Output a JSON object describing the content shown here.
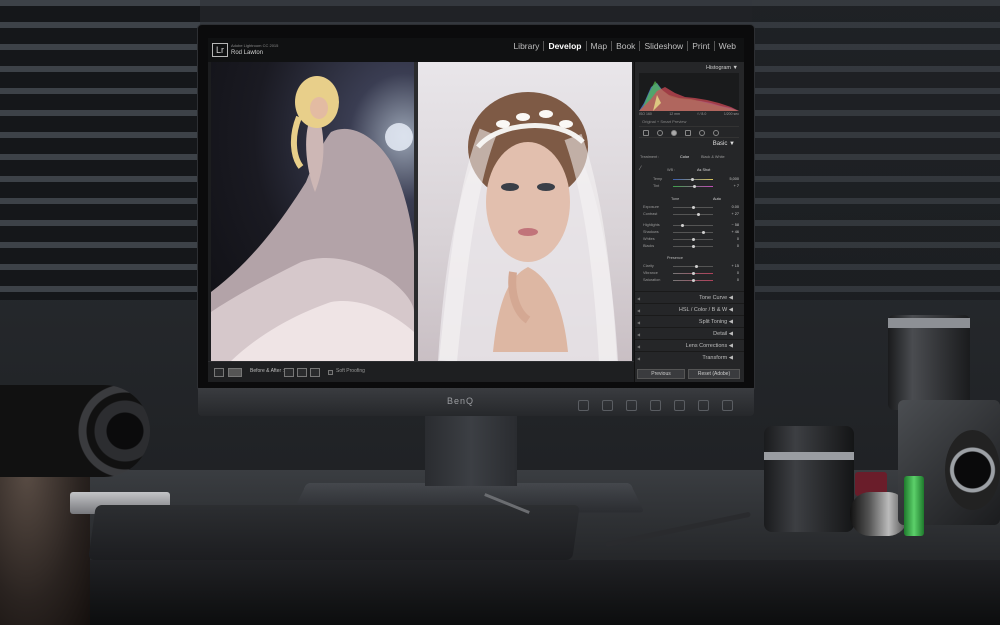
{
  "monitor": {
    "brand": "BenQ"
  },
  "app": {
    "logo": "Lr",
    "product": "Adobe Lightroom CC 2015",
    "user": "Rod Lawton",
    "modules": [
      {
        "label": "Library",
        "active": false
      },
      {
        "label": "Develop",
        "active": true
      },
      {
        "label": "Map",
        "active": false
      },
      {
        "label": "Book",
        "active": false
      },
      {
        "label": "Slideshow",
        "active": false
      },
      {
        "label": "Print",
        "active": false
      },
      {
        "label": "Web",
        "active": false
      }
    ]
  },
  "toolbar": {
    "before_after_label": "Before & After :",
    "soft_proofing_label": "Soft Proofing"
  },
  "panel": {
    "histogram_title": "Histogram ▼",
    "histogram_stats": [
      "ISO 160",
      "12 mm",
      "f / 8.0",
      "1/200 sec"
    ],
    "preview_label": "Original + Smart Preview",
    "basic": {
      "title": "Basic ▼",
      "treatment_label": "Treatment :",
      "color_label": "Color",
      "bw_label": "Black & White",
      "wb_label": "WB :",
      "wb_value": "As Shot",
      "temp_label": "Temp",
      "temp_value": "5,000",
      "tint_label": "Tint",
      "tint_value": "+ 7",
      "tone_label": "Tone",
      "auto_label": "Auto",
      "exposure_label": "Exposure",
      "exposure_value": "0.00",
      "contrast_label": "Contrast",
      "contrast_value": "+ 27",
      "highlights_label": "Highlights",
      "highlights_value": "− 58",
      "shadows_label": "Shadows",
      "shadows_value": "+ 46",
      "whites_label": "Whites",
      "whites_value": "0",
      "blacks_label": "Blacks",
      "blacks_value": "0",
      "presence_label": "Presence",
      "clarity_label": "Clarity",
      "clarity_value": "+ 15",
      "vibrance_label": "Vibrance",
      "vibrance_value": "0",
      "saturation_label": "Saturation",
      "saturation_value": "0"
    },
    "sections": [
      "Tone Curve ◀",
      "HSL / Color / B & W ◀",
      "Split Toning ◀",
      "Detail ◀",
      "Lens Corrections ◀",
      "Transform ◀"
    ],
    "previous_button": "Previous",
    "reset_button": "Reset (Adobe)"
  },
  "colors": {
    "ui_background": "#252628",
    "topbar": "#101112",
    "active_module": "#ffffff"
  }
}
